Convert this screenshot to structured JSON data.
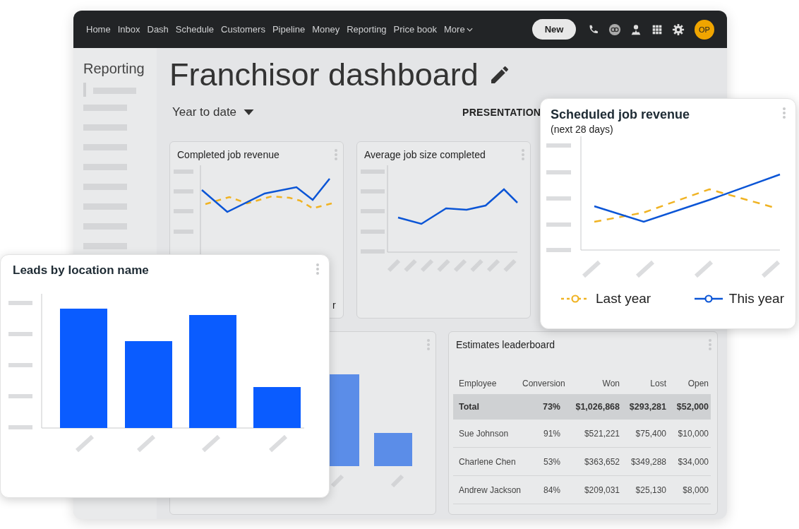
{
  "nav": {
    "items": [
      "Home",
      "Inbox",
      "Dash",
      "Schedule",
      "Customers",
      "Pipeline",
      "Money",
      "Reporting",
      "Price book"
    ],
    "more": "More",
    "new_button": "New",
    "avatar": "OP"
  },
  "sidebar": {
    "title": "Reporting"
  },
  "page": {
    "title": "Franchisor dashboard",
    "date_range": "Year to date",
    "presentation": "PRESENTATION"
  },
  "completed_job_revenue": {
    "title": "Completed job revenue",
    "legend_fragment": "r"
  },
  "average_job_size": {
    "title": "Average job size completed"
  },
  "estimates_leaderboard": {
    "title": "Estimates leaderboard",
    "columns": [
      "Employee",
      "Conversion",
      "Won",
      "Lost",
      "Open"
    ],
    "rows": [
      {
        "kind": "total",
        "cells": [
          "Total",
          "73%",
          "$1,026,868",
          "$293,281",
          "$52,000"
        ]
      },
      {
        "kind": "person",
        "cells": [
          "Sue Johnson",
          "91%",
          "$521,221",
          "$75,400",
          "$10,000"
        ]
      },
      {
        "kind": "person",
        "cells": [
          "Charlene Chen",
          "53%",
          "$363,652",
          "$349,288",
          "$34,000"
        ]
      },
      {
        "kind": "person",
        "cells": [
          "Andrew Jackson",
          "84%",
          "$209,031",
          "$25,130",
          "$8,000"
        ]
      }
    ]
  },
  "leads_by_location": {
    "title": "Leads by location name"
  },
  "scheduled_job_revenue": {
    "title": "Scheduled job revenue",
    "subtitle": "(next 28 days)",
    "legend": [
      {
        "label": "Last year",
        "kind": "dashed",
        "color": "#f0b323"
      },
      {
        "label": "This year",
        "kind": "solid",
        "color": "#0b55d6"
      }
    ]
  }
}
